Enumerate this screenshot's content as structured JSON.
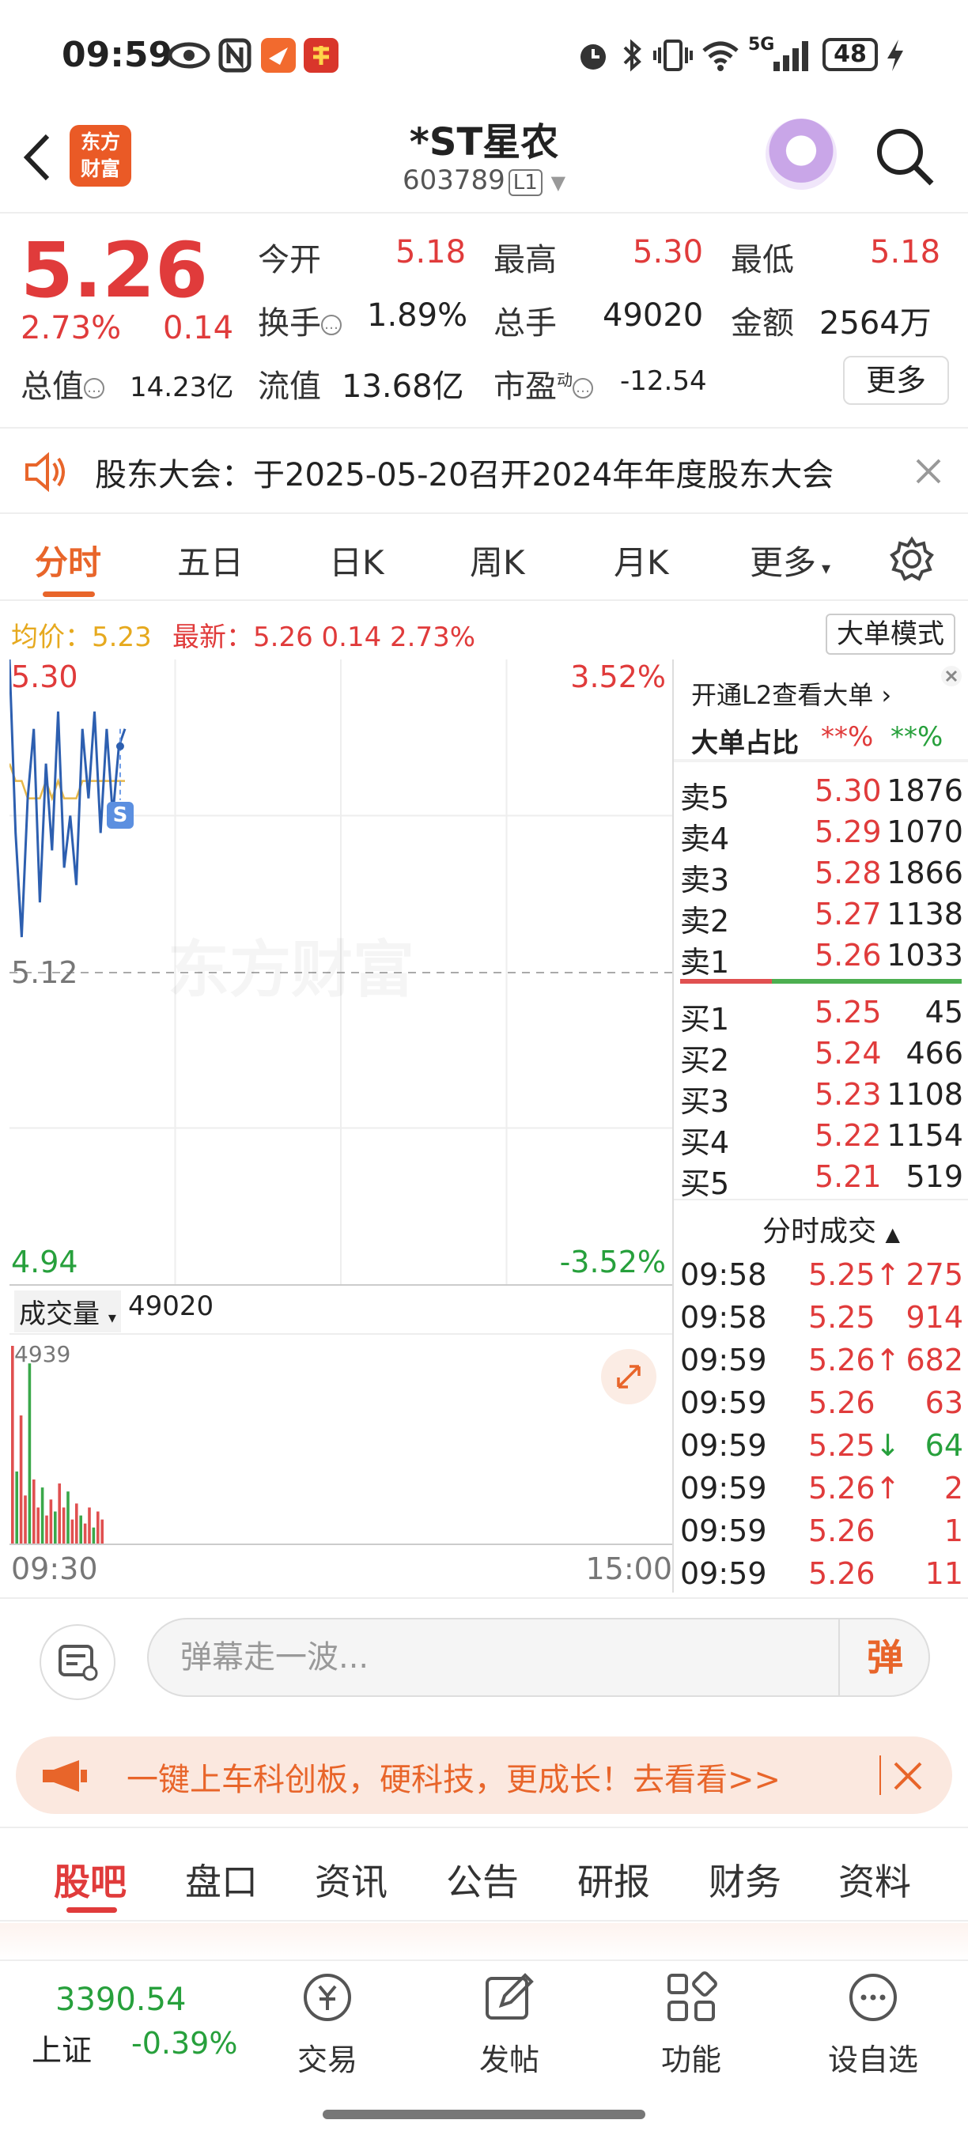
{
  "status_bar": {
    "time": "09:59",
    "network": "5G",
    "battery": "48"
  },
  "header": {
    "title": "*ST星农",
    "code": "603789",
    "level": "L1",
    "logo_text": "东方财富"
  },
  "quote": {
    "price": "5.26",
    "change_pct": "2.73%",
    "change": "0.14",
    "open_label": "今开",
    "open": "5.18",
    "high_label": "最高",
    "high": "5.30",
    "low_label": "最低",
    "low": "5.18",
    "turnover_label": "换手",
    "turnover": "1.89%",
    "volume_label": "总手",
    "volume": "49020",
    "amount_label": "金额",
    "amount": "2564万",
    "mcap_label": "总值",
    "mcap": "14.23亿",
    "float_label": "流值",
    "float_value": "13.68亿",
    "pe_label": "市盈",
    "pe_sup": "动",
    "pe": "-12.54",
    "more_button": "更多"
  },
  "notice": {
    "text": "股东大会：于2025-05-20召开2024年年度股东大会"
  },
  "tabs": [
    "分时",
    "五日",
    "日K",
    "周K",
    "月K",
    "更多"
  ],
  "avg_bar": {
    "avg_label": "均价：",
    "avg": "5.23",
    "latest_label": "最新：",
    "latest": "5.26",
    "change": "0.14",
    "change_pct": "2.73%",
    "big_order_mode": "大单模式"
  },
  "chart": {
    "y_top": "5.30",
    "y_mid": "5.12",
    "y_bottom": "4.94",
    "pct_top": "3.52%",
    "pct_bottom": "-3.52%",
    "volume_label": "成交量",
    "volume_value": "49020",
    "volume_max": "4939",
    "time_start": "09:30",
    "time_end": "15:00",
    "watermark": "东方财富",
    "marker": "S"
  },
  "chart_data": {
    "type": "line",
    "ylim": [
      4.94,
      5.3
    ],
    "prev_close": 5.12,
    "series": [
      {
        "values": [
          5.3,
          5.2,
          5.14,
          5.22,
          5.26,
          5.16,
          5.24,
          5.19,
          5.27,
          5.18,
          5.21,
          5.17,
          5.26,
          5.22,
          5.27,
          5.2,
          5.26,
          5.21,
          5.25,
          5.26
        ]
      },
      {
        "values": [
          5.24,
          5.23,
          5.23,
          5.22,
          5.22,
          5.22,
          5.23,
          5.22,
          5.23,
          5.22,
          5.22,
          5.22,
          5.23,
          5.23,
          5.23,
          5.23,
          5.23,
          5.23,
          5.23,
          5.23
        ]
      }
    ],
    "volume": [
      4939,
      1800,
      3200,
      1200,
      4500,
      1600,
      900,
      1400,
      700,
      1100,
      800,
      1500,
      900,
      1300,
      600,
      1000,
      700,
      500,
      900,
      400,
      800,
      600
    ]
  },
  "order_book": {
    "l2_promo": "开通L2查看大单",
    "big_ratio_label": "大单占比",
    "big_ratio_buy": "**%",
    "big_ratio_sell": "**%",
    "asks": [
      {
        "label": "卖5",
        "price": "5.30",
        "vol": "1876"
      },
      {
        "label": "卖4",
        "price": "5.29",
        "vol": "1070"
      },
      {
        "label": "卖3",
        "price": "5.28",
        "vol": "1866"
      },
      {
        "label": "卖2",
        "price": "5.27",
        "vol": "1138"
      },
      {
        "label": "卖1",
        "price": "5.26",
        "vol": "1033"
      }
    ],
    "bids": [
      {
        "label": "买1",
        "price": "5.25",
        "vol": "45"
      },
      {
        "label": "买2",
        "price": "5.24",
        "vol": "466"
      },
      {
        "label": "买3",
        "price": "5.23",
        "vol": "1108"
      },
      {
        "label": "买4",
        "price": "5.22",
        "vol": "1154"
      },
      {
        "label": "买5",
        "price": "5.21",
        "vol": "519"
      }
    ],
    "trades_label": "分时成交",
    "trades": [
      {
        "time": "09:58",
        "price": "5.25",
        "dir": "↑",
        "vol": "275",
        "vol_color": "red"
      },
      {
        "time": "09:58",
        "price": "5.25",
        "dir": "",
        "vol": "914",
        "vol_color": "red"
      },
      {
        "time": "09:59",
        "price": "5.26",
        "dir": "↑",
        "vol": "682",
        "vol_color": "red"
      },
      {
        "time": "09:59",
        "price": "5.26",
        "dir": "",
        "vol": "63",
        "vol_color": "red"
      },
      {
        "time": "09:59",
        "price": "5.25",
        "dir": "↓",
        "vol": "64",
        "vol_color": "green"
      },
      {
        "time": "09:59",
        "price": "5.26",
        "dir": "↑",
        "vol": "2",
        "vol_color": "red"
      },
      {
        "time": "09:59",
        "price": "5.26",
        "dir": "",
        "vol": "1",
        "vol_color": "red"
      },
      {
        "time": "09:59",
        "price": "5.26",
        "dir": "",
        "vol": "11",
        "vol_color": "red"
      }
    ]
  },
  "danmu": {
    "placeholder": "弹幕走一波...",
    "send_label": "弹"
  },
  "banner": {
    "text": "一键上车科创板，硬科技，更成长！去看看>>"
  },
  "bottom_tabs": [
    "股吧",
    "盘口",
    "资讯",
    "公告",
    "研报",
    "财务",
    "资料"
  ],
  "footer": {
    "index_value": "3390.54",
    "index_name": "上证",
    "index_change": "-0.39%",
    "items": [
      "交易",
      "发帖",
      "功能",
      "设自选"
    ]
  },
  "colors": {
    "up": "#e03b3b",
    "down": "#27a03c",
    "accent": "#e8652a",
    "price_line": "#2d5fb0",
    "avg_line": "#e6b84a"
  }
}
